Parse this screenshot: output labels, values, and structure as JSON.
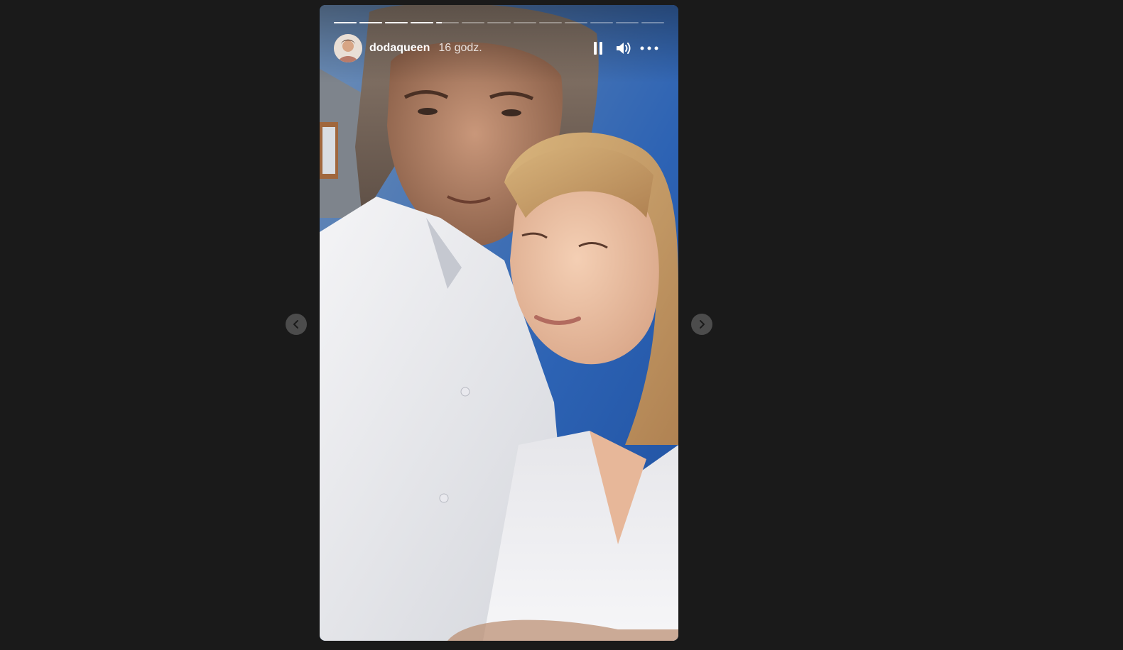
{
  "story": {
    "username": "dodaqueen",
    "time_ago": "16 godz.",
    "progress": {
      "segments": [
        1,
        1,
        1,
        1,
        0.25,
        0,
        0,
        0,
        0,
        0,
        0,
        0,
        0
      ]
    },
    "controls": {
      "pause_icon": "pause-icon",
      "sound_icon": "speaker-volume-icon",
      "more_icon": "more-options-icon"
    }
  },
  "navigation": {
    "prev_icon": "chevron-left-icon",
    "next_icon": "chevron-right-icon"
  },
  "colors": {
    "background": "#1a1a1a",
    "text": "#ffffff",
    "progress_track": "rgba(255,255,255,0.35)",
    "progress_fill": "#ffffff"
  }
}
